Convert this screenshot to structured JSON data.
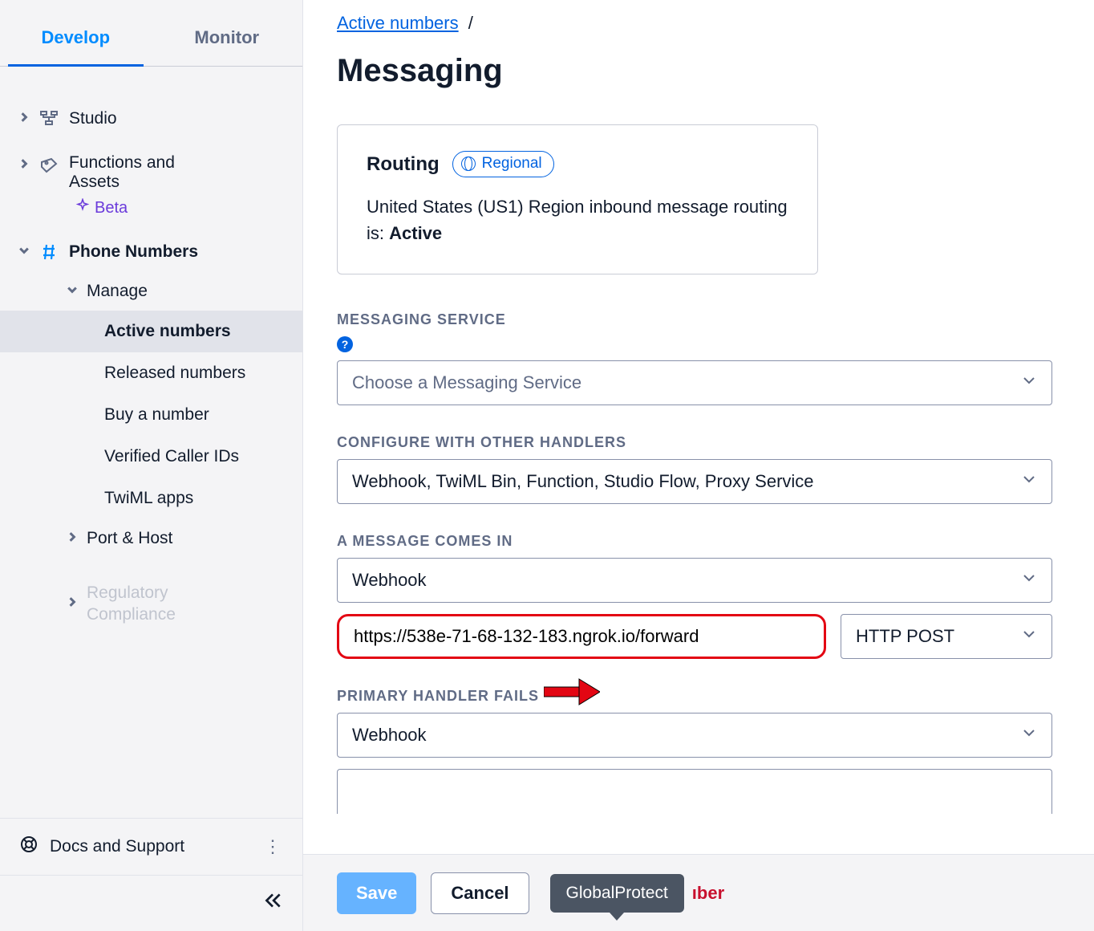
{
  "sidebar": {
    "tabs": {
      "develop": "Develop",
      "monitor": "Monitor"
    },
    "items": {
      "studio": "Studio",
      "functions": "Functions and Assets",
      "beta": "Beta",
      "phone_numbers": "Phone Numbers",
      "manage": "Manage",
      "active_numbers": "Active numbers",
      "released_numbers": "Released numbers",
      "buy_number": "Buy a number",
      "verified_caller_ids": "Verified Caller IDs",
      "twiml_apps": "TwiML apps",
      "port_host": "Port & Host",
      "regulatory": "Regulatory Compliance"
    },
    "docs": "Docs and Support"
  },
  "breadcrumb": {
    "active_numbers": "Active numbers",
    "sep": "/"
  },
  "page_title": "Messaging",
  "routing_card": {
    "title": "Routing",
    "pill": "Regional",
    "line1": "United States (US1) Region inbound message routing is: ",
    "status": "Active"
  },
  "labels": {
    "messaging_service": "MESSAGING SERVICE",
    "configure_with": "CONFIGURE WITH OTHER HANDLERS",
    "message_comes_in": "A MESSAGE COMES IN",
    "primary_fails": "PRIMARY HANDLER FAILS"
  },
  "selects": {
    "messaging_placeholder": "Choose a Messaging Service",
    "handlers": "Webhook, TwiML Bin, Function, Studio Flow, Proxy Service",
    "webhook": "Webhook",
    "http_post": "HTTP POST"
  },
  "inputs": {
    "webhook_url": "https://538e-71-68-132-183.ngrok.io/forward"
  },
  "footer": {
    "save": "Save",
    "cancel": "Cancel",
    "tooltip": "GlobalProtect",
    "trailing": "ıber"
  }
}
